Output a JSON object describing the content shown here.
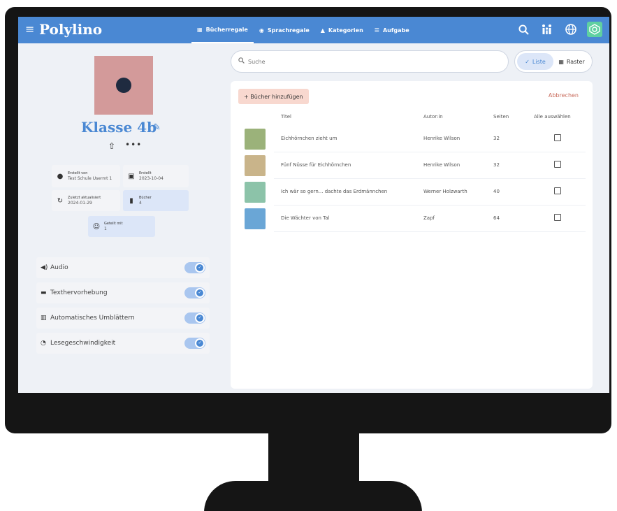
{
  "app": {
    "logo": "Polylino"
  },
  "nav": [
    {
      "label": "Bücherregale",
      "icon": "shelf-icon"
    },
    {
      "label": "Sprachregale",
      "icon": "globe-icon"
    },
    {
      "label": "Kategorien",
      "icon": "shapes-icon"
    },
    {
      "label": "Aufgabe",
      "icon": "list-icon"
    }
  ],
  "profile": {
    "class_name": "Klasse 4b",
    "info": {
      "created_by_label": "Erstellt von",
      "created_by_value": "Test Schule Usermt 1",
      "created_label": "Erstellt",
      "created_value": "2023-10-04",
      "updated_label": "Zuletzt aktualisiert",
      "updated_value": "2024-01-29",
      "books_label": "Bücher",
      "books_value": "4",
      "shared_label": "Geteilt mit",
      "shared_value": "1"
    }
  },
  "settings": [
    {
      "label": "Audio",
      "icon": "speaker-icon",
      "enabled": true
    },
    {
      "label": "Texthervorhebung",
      "icon": "highlight-icon",
      "enabled": true
    },
    {
      "label": "Automatisches Umblättern",
      "icon": "book-icon",
      "enabled": true
    },
    {
      "label": "Lesegeschwindigkeit",
      "icon": "speed-icon",
      "enabled": true
    }
  ],
  "search": {
    "placeholder": "Suche"
  },
  "view": {
    "list_label": "Liste",
    "grid_label": "Raster",
    "active": "list"
  },
  "books_panel": {
    "add_label": "+ Bücher hinzufügen",
    "cancel_label": "Abbrechen",
    "columns": {
      "title": "Titel",
      "author": "Autor:in",
      "pages": "Seiten",
      "select_all": "Alle auswählen"
    },
    "rows": [
      {
        "title": "Eichhörnchen zieht um",
        "author": "Henrike Wilson",
        "pages": "32",
        "cover_color": "#9bb27a"
      },
      {
        "title": "Fünf Nüsse für Eichhörnchen",
        "author": "Henrike Wilson",
        "pages": "32",
        "cover_color": "#c9b48a"
      },
      {
        "title": "Ich wär so gern... dachte das Erdmännchen",
        "author": "Werner Holzwarth",
        "pages": "40",
        "cover_color": "#8cc3a9"
      },
      {
        "title": "Die Wächter von Tal",
        "author": "Zapf",
        "pages": "64",
        "cover_color": "#6aa6d6"
      }
    ]
  },
  "colors": {
    "primary": "#4a88d3",
    "avatar": "#d39a9a",
    "add_button": "#f8d8cf",
    "cancel": "#c86a5a"
  }
}
